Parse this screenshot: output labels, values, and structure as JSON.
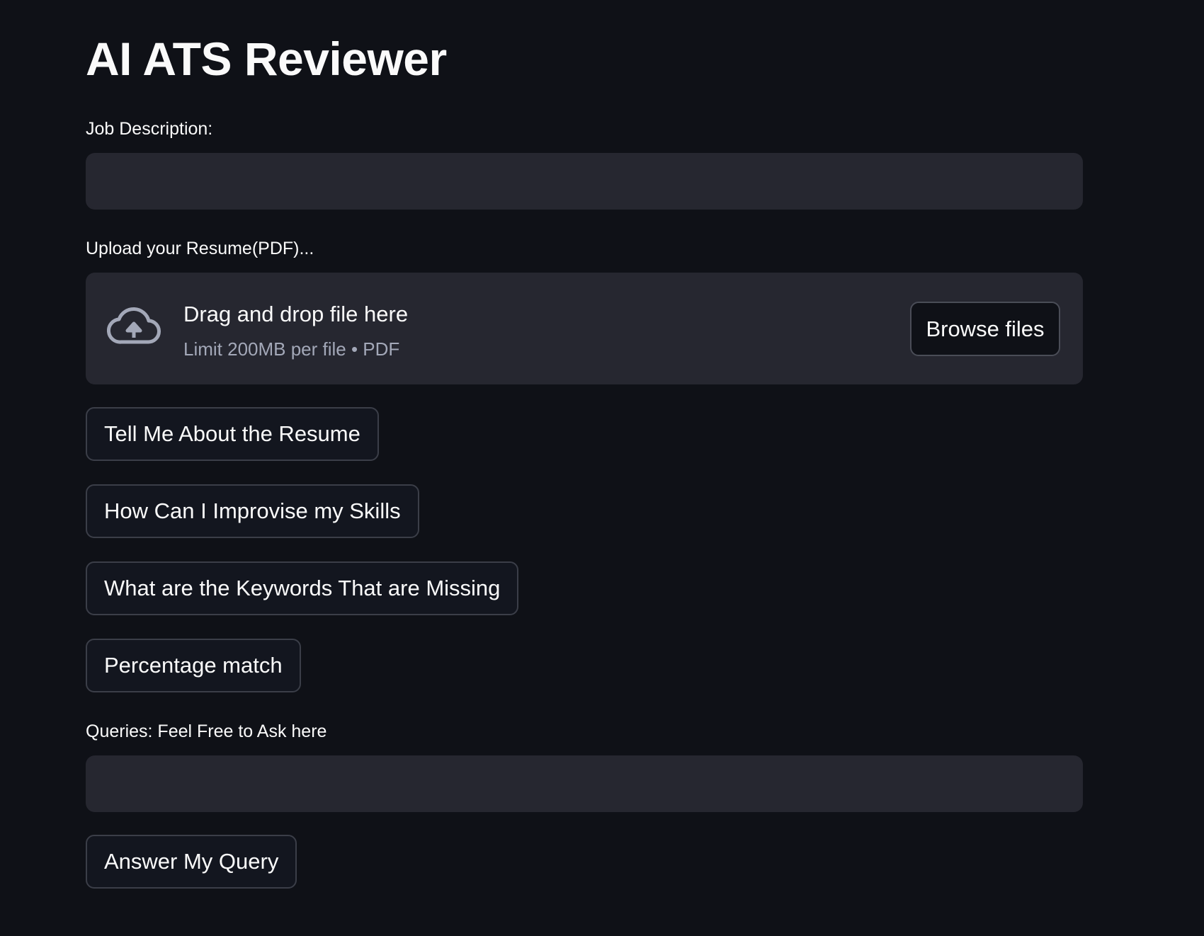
{
  "app": {
    "title": "AI ATS Reviewer"
  },
  "job_description": {
    "label": "Job Description:",
    "value": "",
    "placeholder": ""
  },
  "uploader": {
    "label": "Upload your Resume(PDF)...",
    "title": "Drag and drop file here",
    "subtitle": "Limit 200MB per file • PDF",
    "browse_label": "Browse files",
    "icon": "cloud-upload-icon"
  },
  "actions": {
    "tell_me": "Tell Me About the Resume",
    "improve_skills": "How Can I Improvise my Skills",
    "missing_keywords": "What are the Keywords That are Missing",
    "percentage_match": "Percentage match"
  },
  "query": {
    "label": "Queries: Feel Free to Ask here",
    "value": "",
    "placeholder": "",
    "submit_label": "Answer My Query"
  },
  "colors": {
    "background": "#0f1117",
    "input_background": "#262730",
    "text": "#fafafa",
    "muted_text": "#a3a8b8",
    "button_border": "#3b3e48"
  }
}
